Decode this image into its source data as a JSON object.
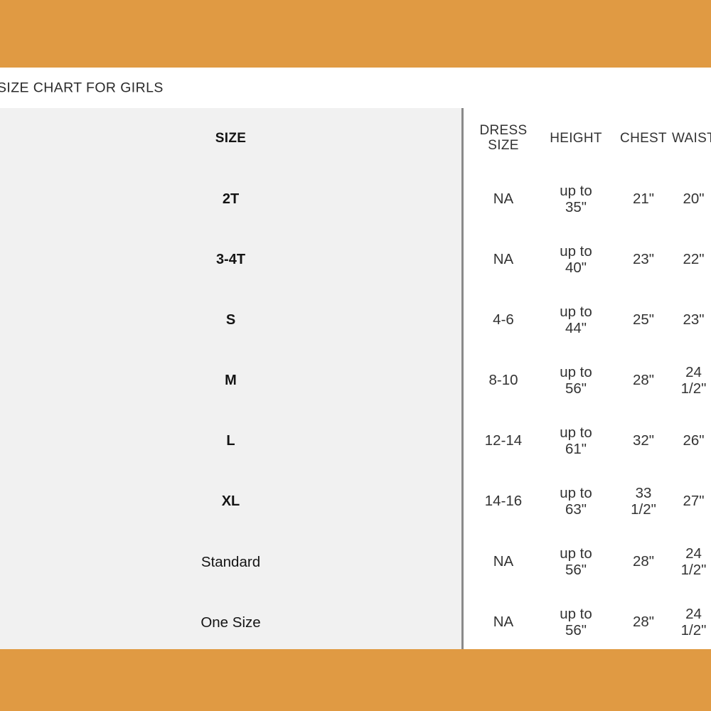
{
  "page": {
    "background_color": "#e09a43",
    "panel_color": "#f1f1f1",
    "divider_color": "#8a8a8a"
  },
  "title": "SIZE CHART FOR GIRLS",
  "chart_data": {
    "type": "table",
    "title": "SIZE CHART FOR GIRLS",
    "columns": [
      "SIZE",
      "DRESS SIZE",
      "HEIGHT",
      "CHEST",
      "WAIST"
    ],
    "headers": {
      "size": "SIZE",
      "dress_size_line1": "DRESS",
      "dress_size_line2": "SIZE",
      "height": "HEIGHT",
      "chest": "CHEST",
      "waist": "WAIST"
    },
    "rows": [
      {
        "size": "2T",
        "dress_size": "NA",
        "height_line1": "up to",
        "height_line2": "35\"",
        "chest_line1": "21\"",
        "chest_line2": "",
        "waist_line1": "20\"",
        "waist_line2": ""
      },
      {
        "size": "3-4T",
        "dress_size": "NA",
        "height_line1": "up to",
        "height_line2": "40\"",
        "chest_line1": "23\"",
        "chest_line2": "",
        "waist_line1": "22\"",
        "waist_line2": ""
      },
      {
        "size": "S",
        "dress_size": "4-6",
        "height_line1": "up to",
        "height_line2": "44\"",
        "chest_line1": "25\"",
        "chest_line2": "",
        "waist_line1": "23\"",
        "waist_line2": ""
      },
      {
        "size": "M",
        "dress_size": "8-10",
        "height_line1": "up to",
        "height_line2": "56\"",
        "chest_line1": "28\"",
        "chest_line2": "",
        "waist_line1": "24",
        "waist_line2": "1/2\""
      },
      {
        "size": "L",
        "dress_size": "12-14",
        "height_line1": "up to",
        "height_line2": "61\"",
        "chest_line1": "32\"",
        "chest_line2": "",
        "waist_line1": "26\"",
        "waist_line2": ""
      },
      {
        "size": "XL",
        "dress_size": "14-16",
        "height_line1": "up to",
        "height_line2": "63\"",
        "chest_line1": "33",
        "chest_line2": "1/2\"",
        "waist_line1": "27\"",
        "waist_line2": ""
      },
      {
        "size": "Standard",
        "dress_size": "NA",
        "height_line1": "up to",
        "height_line2": "56\"",
        "chest_line1": "28\"",
        "chest_line2": "",
        "waist_line1": "24",
        "waist_line2": "1/2\""
      },
      {
        "size": "One Size",
        "dress_size": "NA",
        "height_line1": "up to",
        "height_line2": "56\"",
        "chest_line1": "28\"",
        "chest_line2": "",
        "waist_line1": "24",
        "waist_line2": "1/2\""
      }
    ]
  }
}
